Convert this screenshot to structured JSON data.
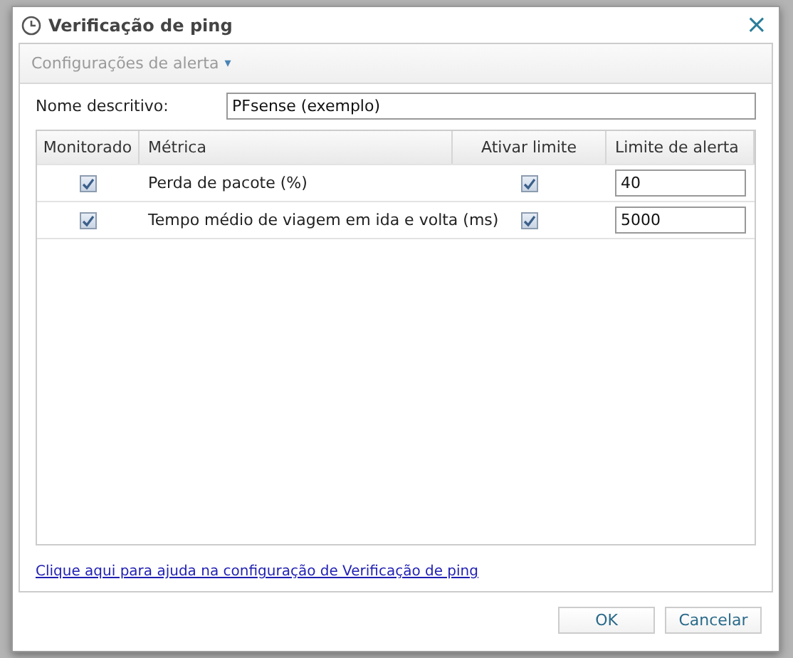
{
  "window": {
    "title": "Verificação de ping",
    "close": "×"
  },
  "section": {
    "title": "Configurações de alerta",
    "caret": "▾",
    "expanded": true
  },
  "name_field": {
    "label": "Nome descritivo:",
    "value": "PFsense (exemplo)"
  },
  "table": {
    "columns": [
      "Monitorado",
      "Métrica",
      "Ativar limite",
      "Limite de alerta"
    ],
    "rows": [
      {
        "monitored": true,
        "metric": "Perda de pacote (%)",
        "limit_enabled": true,
        "threshold": "40"
      },
      {
        "monitored": true,
        "metric": "Tempo médio de viagem em ida e volta (ms)",
        "limit_enabled": true,
        "threshold": "5000"
      }
    ]
  },
  "help_link": "Clique aqui para ajuda na configuração de Verificação de ping",
  "buttons": [
    "OK",
    "Cancelar"
  ]
}
